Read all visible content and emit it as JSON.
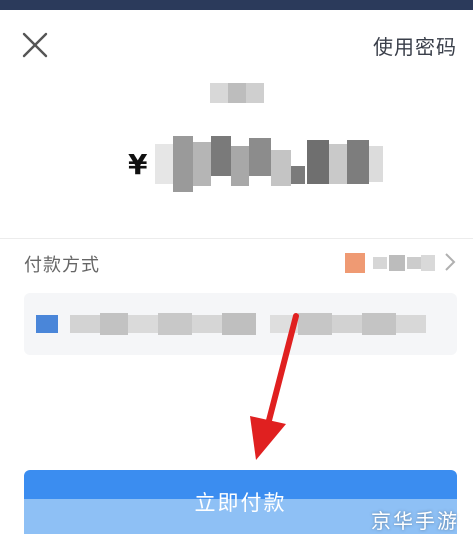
{
  "header": {
    "close_icon": "close-icon",
    "use_password_label": "使用密码"
  },
  "payment": {
    "currency_symbol": "¥",
    "pay_method_label": "付款方式",
    "confirm_button_label": "立即付款"
  },
  "icons": {
    "chevron": "chevron-right-icon",
    "card": "bank-card-icon",
    "annotation": "red-arrow-icon"
  },
  "colors": {
    "accent": "#3b8df0",
    "arrow": "#e02020",
    "header_bar": "#2b3a5b"
  },
  "watermark": "京华手游"
}
